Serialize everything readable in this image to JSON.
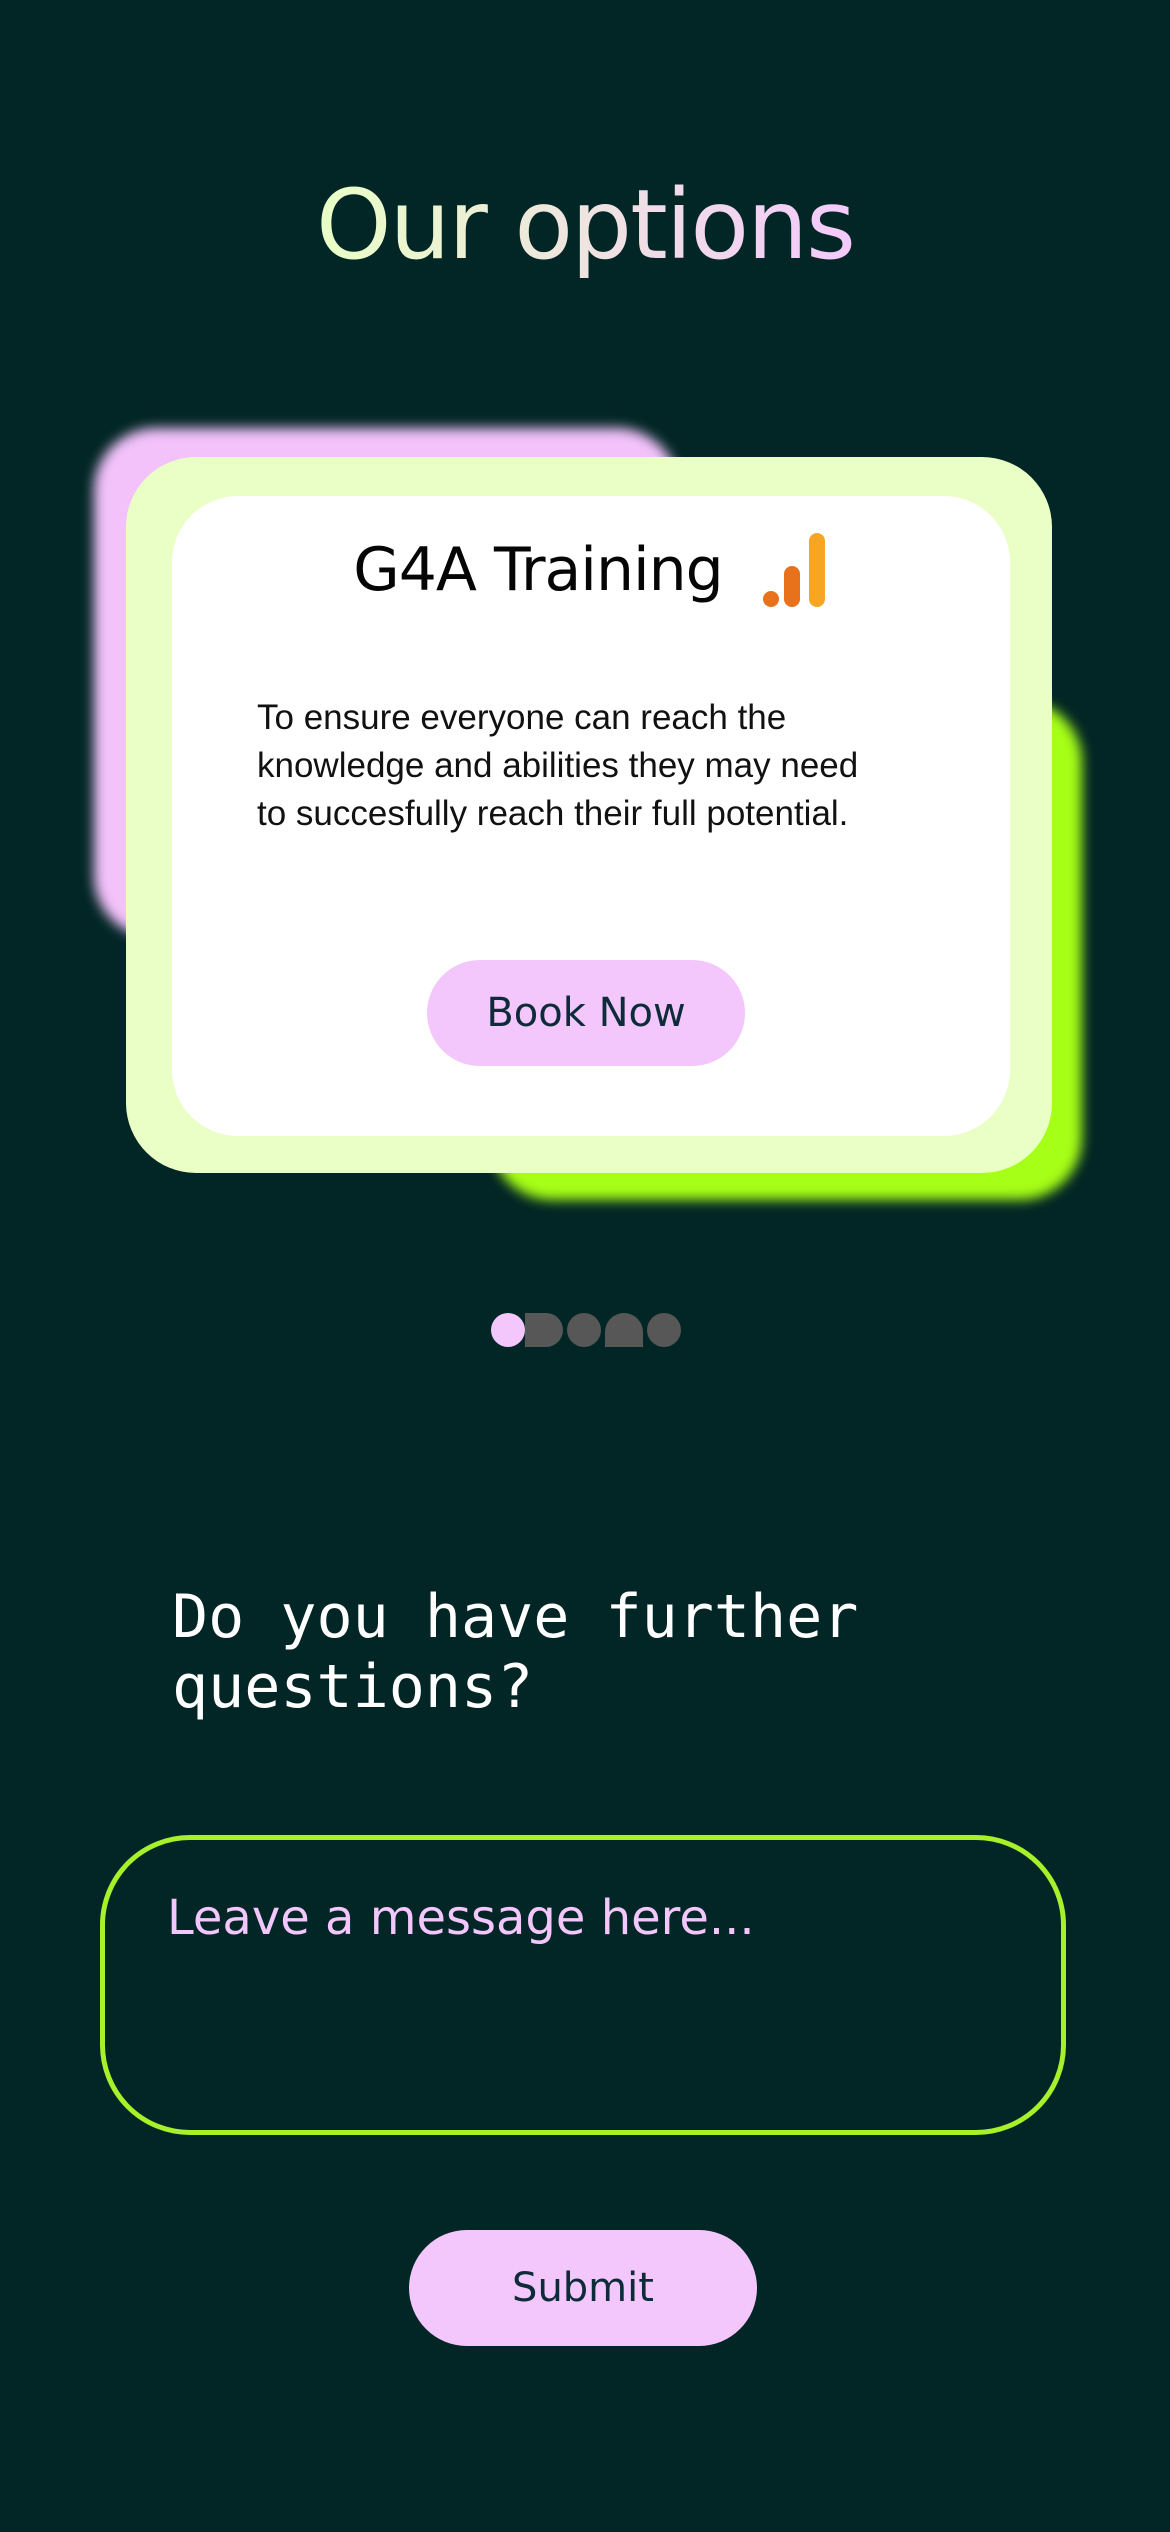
{
  "page": {
    "title": "Our options"
  },
  "card": {
    "title": "G4A Training",
    "icon": "analytics-bars-icon",
    "description": "To ensure everyone can reach the knowledge and abilities they may need to succesfully reach their full potential.",
    "cta_label": "Book Now"
  },
  "carousel": {
    "active_index": 0,
    "dots": [
      "circle",
      "half-circle",
      "circle",
      "dome",
      "circle"
    ]
  },
  "contact": {
    "question": "Do you have further questions?",
    "message_placeholder": "Leave a message here...",
    "message_value": "",
    "submit_label": "Submit"
  },
  "colors": {
    "background": "#022625",
    "accent_pink": "#f3c7fb",
    "accent_green": "#a6ff16",
    "card_outline": "#e9ffc6",
    "icon_orange_light": "#f6a623",
    "icon_orange_dark": "#e8711c"
  }
}
